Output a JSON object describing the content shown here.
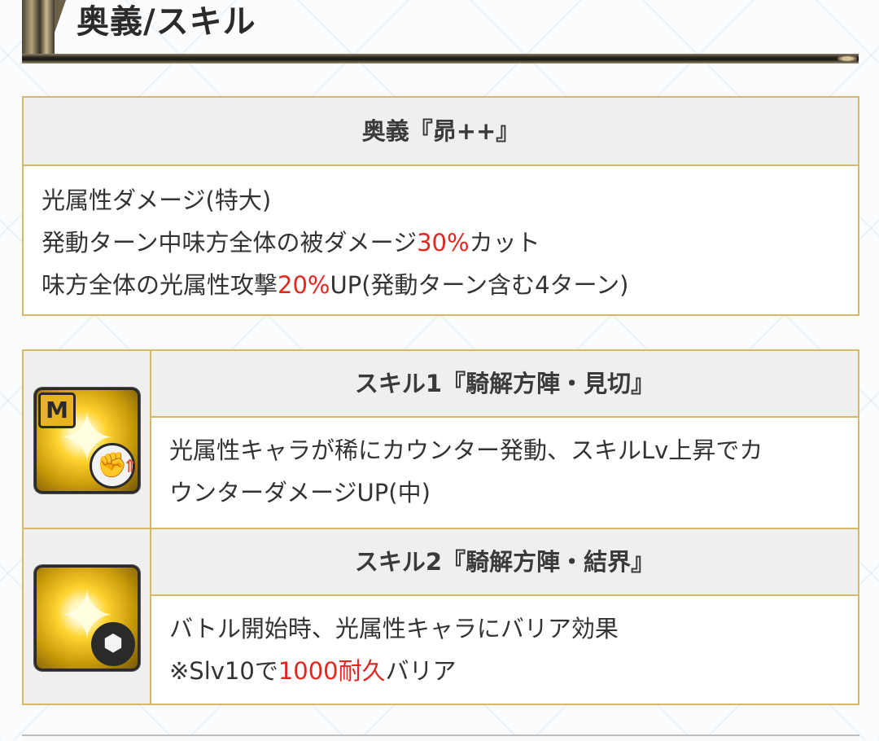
{
  "section": {
    "title": "奥義/スキル"
  },
  "ougi": {
    "title": "奥義『昴++』",
    "lines": [
      {
        "pre": "光属性ダメージ(特大)",
        "red": "",
        "post": ""
      },
      {
        "pre": "発動ターン中味方全体の被ダメージ",
        "red": "30%",
        "post": "カット"
      },
      {
        "pre": "味方全体の光属性攻撃",
        "red": "20%",
        "post": "UP(発動ターン含む4ターン)"
      }
    ]
  },
  "skills": [
    {
      "title": "スキル1『騎解方陣・見切』",
      "icon": "light-counter-skill-icon",
      "badge": "M",
      "lines": [
        {
          "pre": "光属性キャラが稀にカウンター発動、スキルLv上昇でカ",
          "red": "",
          "post": ""
        },
        {
          "pre": "ウンターダメージUP(中)",
          "red": "",
          "post": ""
        }
      ]
    },
    {
      "title": "スキル2『騎解方陣・結界』",
      "icon": "light-barrier-skill-icon",
      "lines": [
        {
          "pre": "バトル開始時、光属性キャラにバリア効果",
          "red": "",
          "post": ""
        },
        {
          "pre": "※Slv10で",
          "red": "1000耐久",
          "post": "バリア"
        }
      ]
    }
  ],
  "colors": {
    "border": "#d7b868",
    "header_bg": "#efefef",
    "highlight": "#e2271f"
  }
}
